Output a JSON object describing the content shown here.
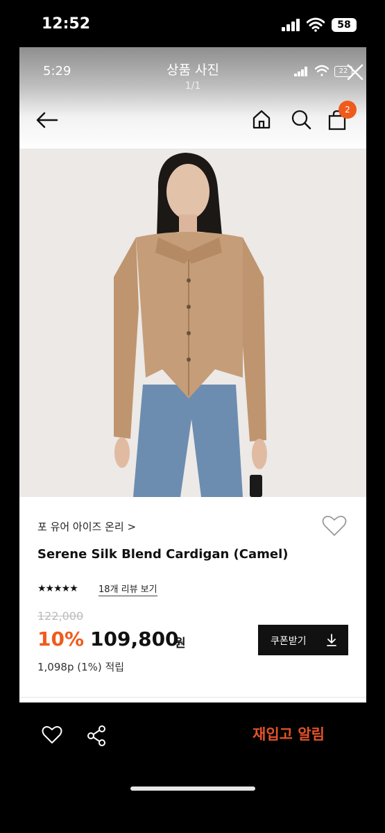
{
  "os_status": {
    "time": "12:52",
    "battery": "58"
  },
  "viewer": {
    "time": "5:29",
    "title": "상품 사진",
    "index": "1/1",
    "battery": "22"
  },
  "nav": {
    "cart_count": "2"
  },
  "product": {
    "brand": "포 유어 아이즈 온리 >",
    "name": "Serene Silk Blend Cardigan (Camel)",
    "rating_stars": "★★★★★",
    "review_link": "18개 리뷰 보기",
    "original_price": "122,000",
    "discount": "10%",
    "price": "109,800",
    "currency": "원",
    "points": "1,098p (1%) 적립"
  },
  "actions": {
    "coupon_label": "쿠폰받기",
    "restock_label": "재입고 알림"
  },
  "colors": {
    "accent": "#ef5b1c",
    "restock": "#e2532a",
    "dark": "#111111"
  },
  "icons": [
    "signal-icon",
    "wifi-icon",
    "battery-icon",
    "close-icon",
    "back-arrow-icon",
    "home-icon",
    "search-icon",
    "shopping-bag-icon",
    "heart-icon",
    "download-icon",
    "share-icon"
  ]
}
